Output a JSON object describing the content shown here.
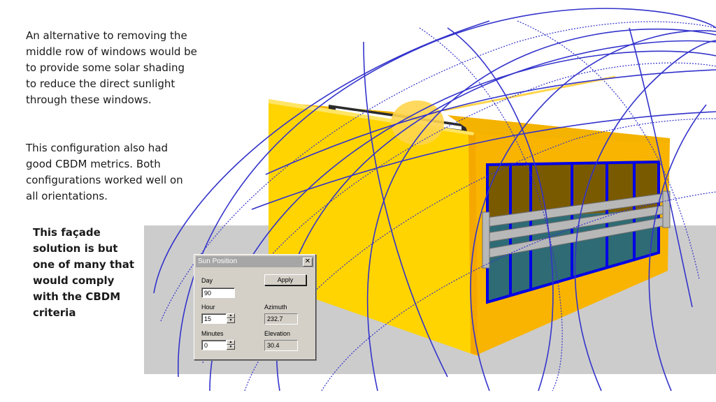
{
  "slide": {
    "para1": "An alternative to removing the middle row of windows would be to provide some solar shading to reduce the direct sunlight through these windows.",
    "para2": "This configuration also had good CBDM metrics. Both configurations worked well on all orientations.",
    "para3": "This façade solution is but one of many that would comply with the CBDM criteria"
  },
  "dialog": {
    "title": "Sun Position",
    "close_symbol": "✕",
    "day_label": "Day",
    "day_value": "90",
    "apply_label": "Apply",
    "hour_label": "Hour",
    "hour_value": "15",
    "azimuth_label": "Azimuth",
    "azimuth_value": "232.7",
    "minutes_label": "Minutes",
    "minutes_value": "0",
    "elevation_label": "Elevation",
    "elevation_value": "30.4"
  },
  "colors": {
    "facade": "#ffd700",
    "facade_side": "#f5a800",
    "window_frame": "#0000e6",
    "sunpath": "#3333cc",
    "ground": "#cccccc"
  }
}
